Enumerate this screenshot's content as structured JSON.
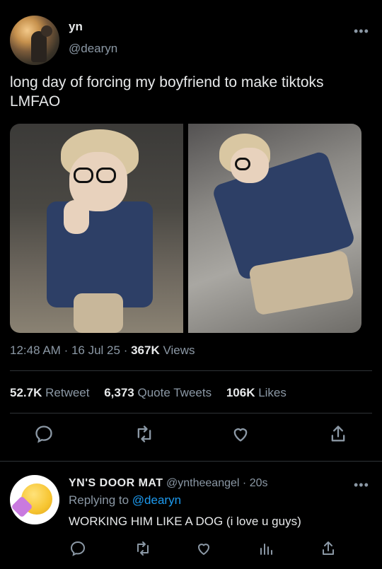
{
  "tweet": {
    "display_name": "yn",
    "handle": "@dearyn",
    "text": "long day of forcing my boyfriend to make tiktoks LMFAO",
    "time": "12:48 AM",
    "date": "16 Jul 25",
    "views_count": "367K",
    "views_label": "Views",
    "retweets_count": "52.7K",
    "retweets_label": "Retweet",
    "quotes_count": "6,373",
    "quotes_label": "Quote Tweets",
    "likes_count": "106K",
    "likes_label": "Likes"
  },
  "reply": {
    "display_name": "YN'S  DOOR MAT",
    "handle": "@yntheeangel",
    "time": "20s",
    "replying_prefix": "Replying to",
    "replying_to": "@dearyn",
    "text": "WORKING HIM LIKE A DOG (i love u guys)"
  },
  "icons": {
    "reply": "reply-icon",
    "retweet": "retweet-icon",
    "like": "like-icon",
    "share": "share-icon",
    "analytics": "analytics-icon",
    "more": "more-icon"
  },
  "colors": {
    "background": "#000000",
    "text": "#e7e9ea",
    "muted": "#8b98a5",
    "link": "#1d9bf0",
    "divider": "#2f3336"
  }
}
